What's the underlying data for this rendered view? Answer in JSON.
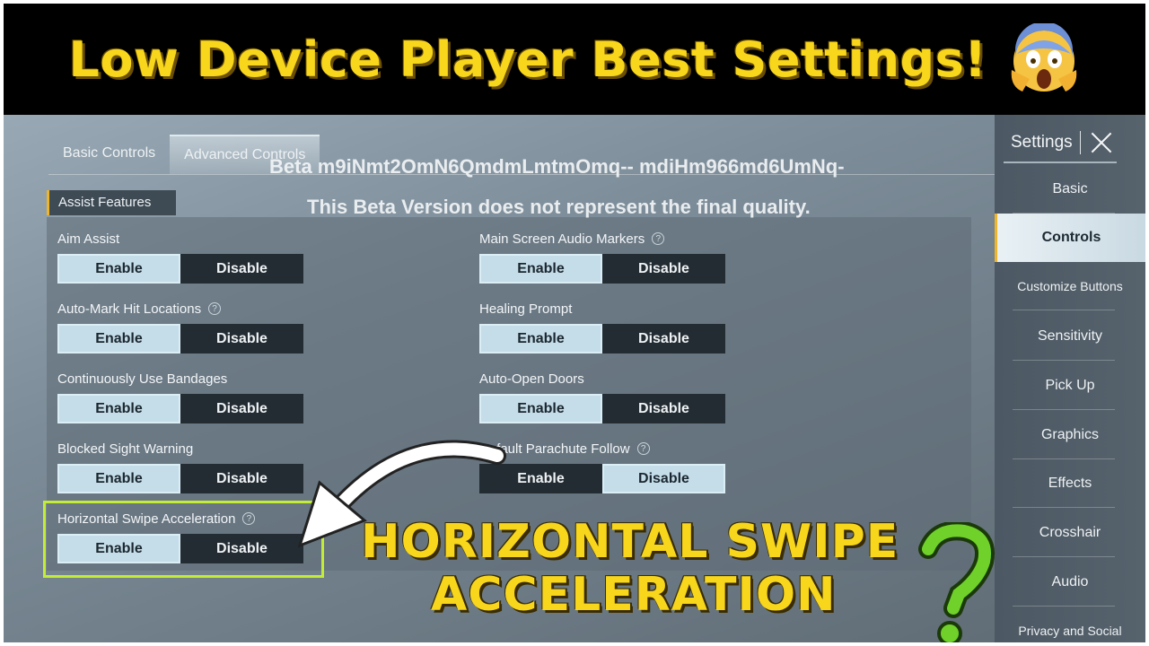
{
  "banner": {
    "title": "Low Device Player Best Settings!",
    "emoji": "screaming-face-emoji"
  },
  "tabs": [
    {
      "label": "Basic Controls",
      "active": false
    },
    {
      "label": "Advanced Controls",
      "active": true
    }
  ],
  "beta": {
    "line1": "Beta m9iNmt2OmN6QmdmLmtmOmq-- mdiHm966md6UmNq-",
    "line2": "This Beta Version does not represent the final quality."
  },
  "section": {
    "title": "Assist Features"
  },
  "options": {
    "enable": "Enable",
    "disable": "Disable"
  },
  "settings_left": [
    {
      "label": "Aim Assist",
      "help": false,
      "value": "Enable"
    },
    {
      "label": "Auto-Mark Hit Locations",
      "help": true,
      "value": "Enable"
    },
    {
      "label": "Continuously Use Bandages",
      "help": false,
      "value": "Enable"
    },
    {
      "label": "Blocked Sight Warning",
      "help": false,
      "value": "Enable"
    },
    {
      "label": "Horizontal Swipe Acceleration",
      "help": true,
      "value": "Enable"
    }
  ],
  "settings_right": [
    {
      "label": "Main Screen Audio Markers",
      "help": true,
      "value": "Enable"
    },
    {
      "label": "Healing Prompt",
      "help": false,
      "value": "Enable"
    },
    {
      "label": "Auto-Open Doors",
      "help": false,
      "value": "Enable"
    },
    {
      "label": "Default Parachute Follow",
      "help": true,
      "value": "Disable"
    }
  ],
  "sidebar": {
    "title": "Settings",
    "items": [
      {
        "label": "Basic",
        "active": false
      },
      {
        "label": "Controls",
        "active": true
      },
      {
        "label": "Customize Buttons",
        "active": false
      },
      {
        "label": "Sensitivity",
        "active": false
      },
      {
        "label": "Pick Up",
        "active": false
      },
      {
        "label": "Graphics",
        "active": false
      },
      {
        "label": "Effects",
        "active": false
      },
      {
        "label": "Crosshair",
        "active": false
      },
      {
        "label": "Audio",
        "active": false
      },
      {
        "label": "Privacy and Social",
        "active": false
      }
    ]
  },
  "overlay": {
    "line1": "HORIZONTAL SWIPE",
    "line2": "ACCELERATION",
    "question_mark": "?"
  },
  "colors": {
    "banner_text": "#f7d61c",
    "highlight": "#c3ec36",
    "accent": "#f0b428",
    "enabled_fill": "#c5dde8",
    "disabled_fill": "#232c33"
  }
}
